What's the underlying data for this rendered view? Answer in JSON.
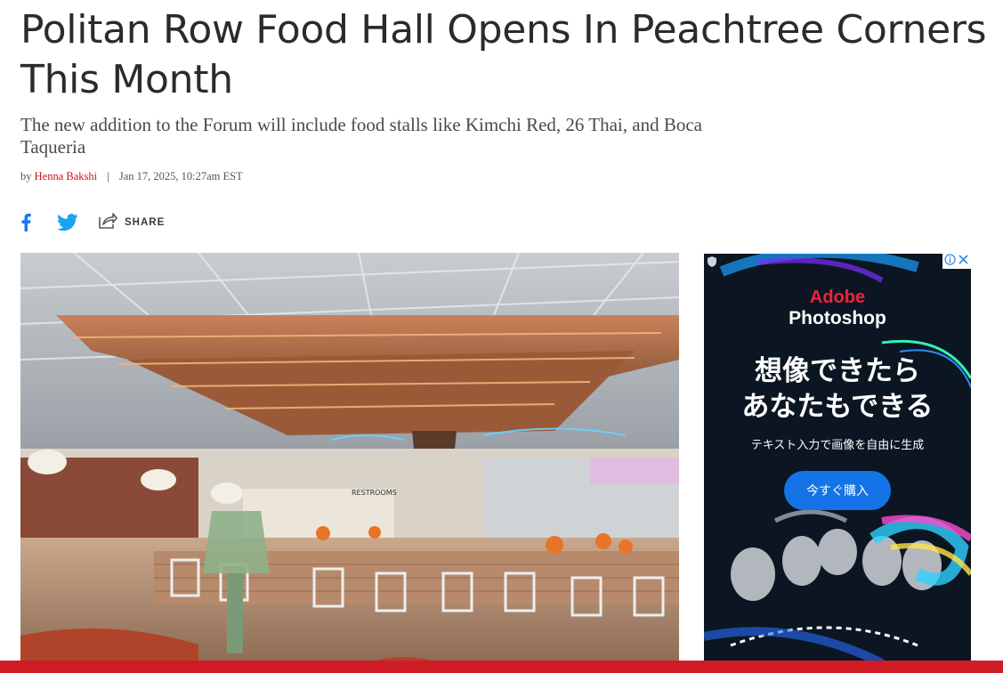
{
  "article": {
    "headline": "Politan Row Food Hall Opens In Peachtree Corners This Month",
    "dek": "The new addition to the Forum will include food stalls like Kimchi Red, 26 Thai, and Boca Taqueria",
    "byline_prefix": "by",
    "author": "Henna Bakshi",
    "separator": "|",
    "timestamp": "Jan 17, 2025, 10:27am EST"
  },
  "share": {
    "label": "SHARE",
    "icons": [
      "facebook-icon",
      "twitter-icon",
      "share-icon"
    ]
  },
  "hero_image": {
    "description_icon": "food-hall-photo",
    "sign_text": "RESTROOMS"
  },
  "ad": {
    "brand_line1": "Adobe",
    "brand_line2": "Photoshop",
    "headline_line1": "想像できたら",
    "headline_line2": "あなたもできる",
    "subtext": "テキスト入力で画像を自由に生成",
    "cta_label": "今すぐ購入",
    "choices_icons": [
      "adchoices-icon",
      "close-icon"
    ]
  },
  "colors": {
    "accent_red": "#c9101c",
    "facebook_blue": "#1877f2",
    "twitter_blue": "#1da1f2",
    "ad_background": "#0b1622",
    "ad_button": "#1473e6",
    "adobe_red": "#f2213b",
    "bottom_bar": "#d01c25"
  }
}
